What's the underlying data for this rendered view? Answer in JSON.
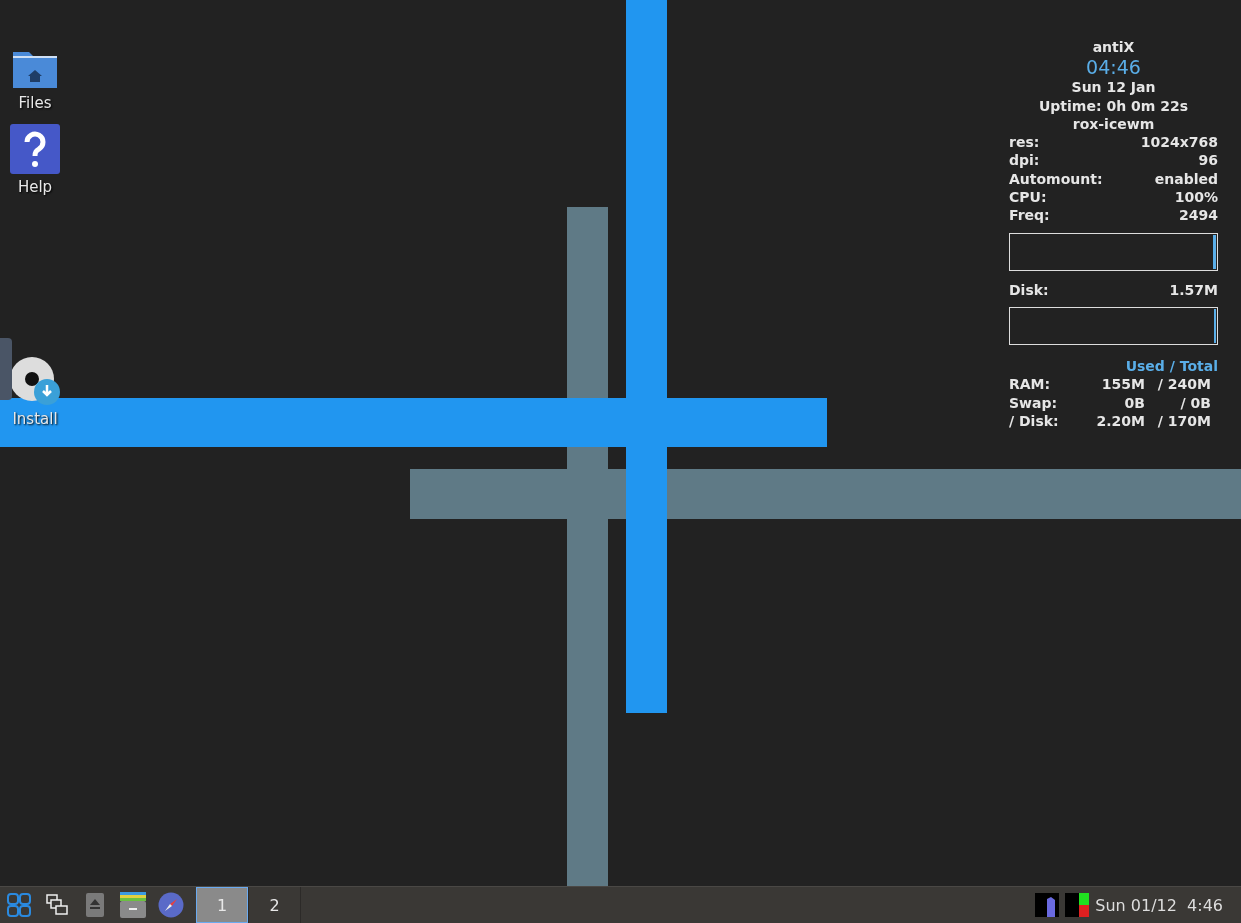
{
  "desktop_icons": [
    {
      "kind": "folder",
      "label": "Files"
    },
    {
      "kind": "help",
      "label": "Help"
    },
    {
      "kind": "install",
      "label": "Install"
    }
  ],
  "conky": {
    "title": "antiX",
    "time": "04:46",
    "date": "Sun 12 Jan",
    "uptime": "Uptime: 0h 0m 22s",
    "session": "rox-icewm",
    "stats": [
      {
        "label": "res:",
        "value": "1024x768"
      },
      {
        "label": "dpi:",
        "value": "96"
      },
      {
        "label": "Automount:",
        "value": "enabled"
      },
      {
        "label": "CPU:",
        "value": "100%"
      },
      {
        "label": "Freq:",
        "value": "2494"
      }
    ],
    "disk": {
      "label": "Disk:",
      "value": "1.57M"
    },
    "memory_header": "Used / Total",
    "memory": [
      {
        "label": "RAM:",
        "used": "155M",
        "total": "/ 240M"
      },
      {
        "label": "Swap:",
        "used": "0B",
        "total": "/ 0B"
      },
      {
        "label": "/ Disk:",
        "used": "2.20M",
        "total": "/ 170M"
      }
    ]
  },
  "taskbar": {
    "launchers": [
      {
        "kind": "start"
      },
      {
        "kind": "windows"
      },
      {
        "kind": "eject"
      },
      {
        "kind": "files"
      },
      {
        "kind": "browser"
      }
    ],
    "workspaces": [
      {
        "label": "1",
        "selected": true
      },
      {
        "label": "2",
        "selected": false
      }
    ],
    "clock": "Sun 01/12  4:46"
  }
}
